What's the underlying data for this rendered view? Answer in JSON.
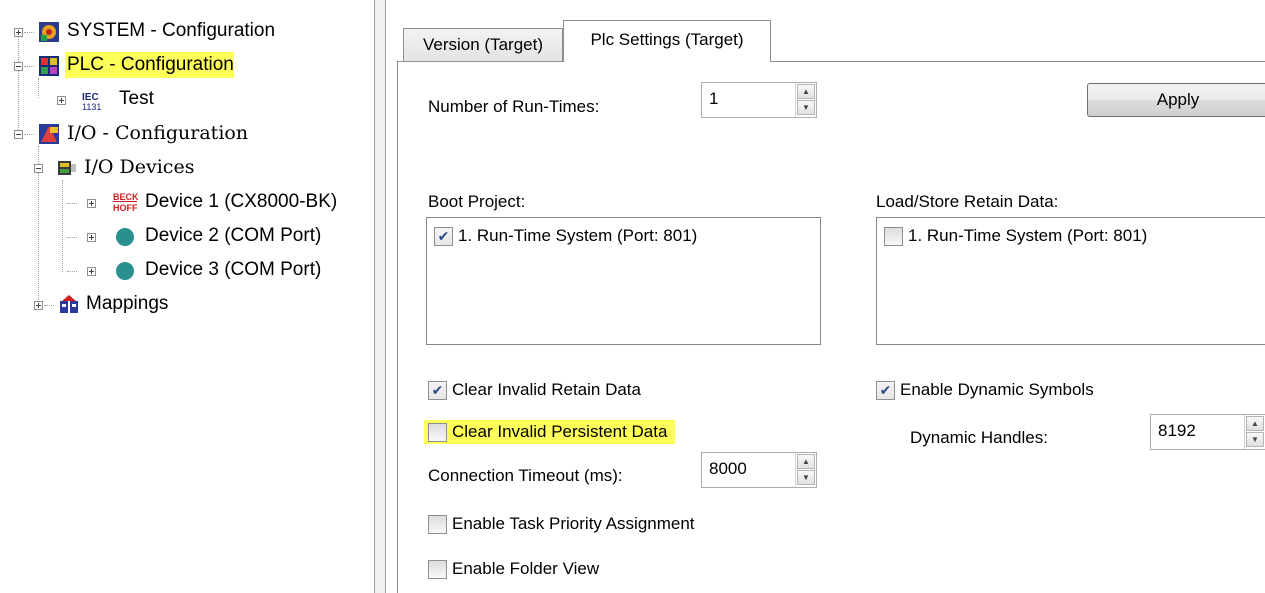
{
  "tree": {
    "system": "SYSTEM - Configuration",
    "plc": "PLC - Configuration",
    "test": "Test",
    "io": "I/O - Configuration",
    "io_devices": "I/O Devices",
    "device1": "Device 1 (CX8000-BK)",
    "device2": "Device 2 (COM Port)",
    "device3": "Device 3 (COM Port)",
    "mappings": "Mappings",
    "iec_icon_text": "IEC 1131",
    "beckhoff_icon_text": "BECK HOFF"
  },
  "tabs": {
    "version": "Version (Target)",
    "plc_settings": "Plc Settings (Target)"
  },
  "settings": {
    "run_times_label": "Number of Run-Times:",
    "run_times_value": "1",
    "apply_label": "Apply",
    "boot_project_label": "Boot Project:",
    "boot_project_item": "1. Run-Time System (Port: 801)",
    "boot_project_checked": true,
    "retain_label": "Load/Store Retain Data:",
    "retain_item": "1. Run-Time System (Port: 801)",
    "retain_checked": false,
    "clear_retain_label": "Clear Invalid Retain Data",
    "clear_retain_checked": true,
    "clear_persistent_label": "Clear Invalid Persistent Data",
    "clear_persistent_checked": false,
    "connection_timeout_label": "Connection Timeout (ms):",
    "connection_timeout_value": "8000",
    "task_priority_label": "Enable Task Priority Assignment",
    "task_priority_checked": false,
    "folder_view_label": "Enable Folder View",
    "folder_view_checked": false,
    "dynamic_symbols_label": "Enable Dynamic Symbols",
    "dynamic_symbols_checked": true,
    "dynamic_handles_label": "Dynamic Handles:",
    "dynamic_handles_value": "8192"
  },
  "colors": {
    "highlight": "#ffff5a",
    "device_dot": "#2a8f8f",
    "check": "#2a4e8a"
  }
}
